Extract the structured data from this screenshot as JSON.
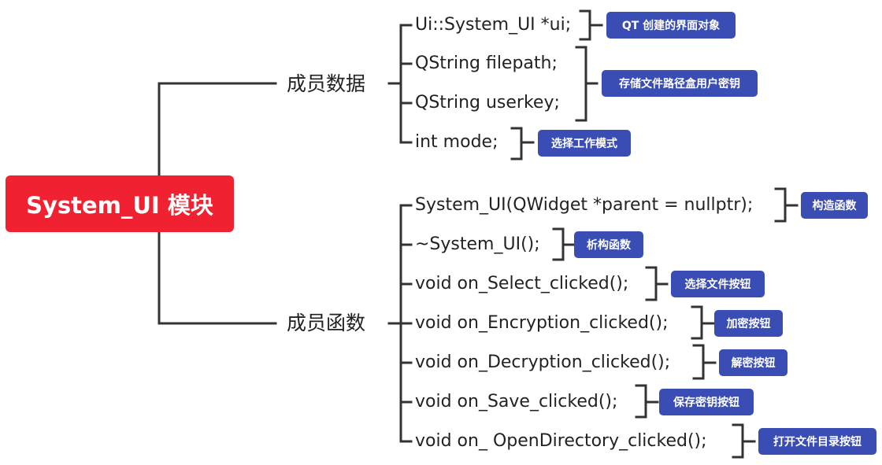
{
  "root": {
    "label": "System_UI 模块"
  },
  "groups": [
    {
      "label": "成员数据",
      "items": [
        "Ui::System_UI *ui;",
        "QString filepath;",
        "QString userkey;",
        "int mode;"
      ],
      "notes": [
        "QT 创建的界面对象",
        "存储文件路径盒用户密钥",
        "选择工作模式"
      ]
    },
    {
      "label": "成员函数",
      "items": [
        "System_UI(QWidget *parent = nullptr);",
        "~System_UI();",
        "void on_Select_clicked();",
        "void on_Encryption_clicked();",
        "void on_Decryption_clicked();",
        "void on_Save_clicked();",
        "void on_ OpenDirectory_clicked();"
      ],
      "notes": [
        "构造函数",
        "析构函数",
        "选择文件按钮",
        "加密按钮",
        "解密按钮",
        "保存密钥按钮",
        "打开文件目录按钮"
      ]
    }
  ],
  "colors": {
    "root_fill": "#f02231",
    "badge_fill": "#3a4db4",
    "line": "#333333",
    "text": "#222222"
  }
}
